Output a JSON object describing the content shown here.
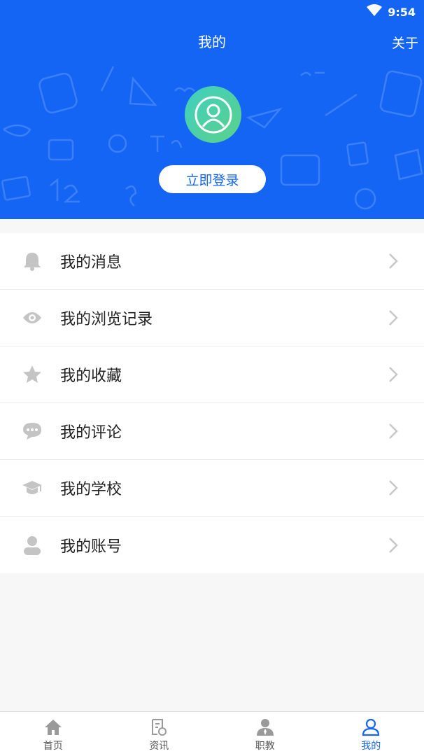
{
  "status": {
    "time": "9:54"
  },
  "header": {
    "title": "我的",
    "about": "关于",
    "login_button": "立即登录"
  },
  "menu": [
    {
      "label": "我的消息",
      "icon": "bell-icon"
    },
    {
      "label": "我的浏览记录",
      "icon": "eye-icon"
    },
    {
      "label": "我的收藏",
      "icon": "star-icon"
    },
    {
      "label": "我的评论",
      "icon": "chat-bubble-icon"
    },
    {
      "label": "我的学校",
      "icon": "graduation-cap-icon"
    },
    {
      "label": "我的账号",
      "icon": "user-icon"
    }
  ],
  "tabs": [
    {
      "label": "首页",
      "icon": "home-icon",
      "active": false
    },
    {
      "label": "资讯",
      "icon": "news-icon",
      "active": false
    },
    {
      "label": "职教",
      "icon": "teacher-icon",
      "active": false
    },
    {
      "label": "我的",
      "icon": "profile-icon",
      "active": true
    }
  ],
  "colors": {
    "primary": "#1565f5",
    "icon_gray": "#c4c4c4"
  }
}
